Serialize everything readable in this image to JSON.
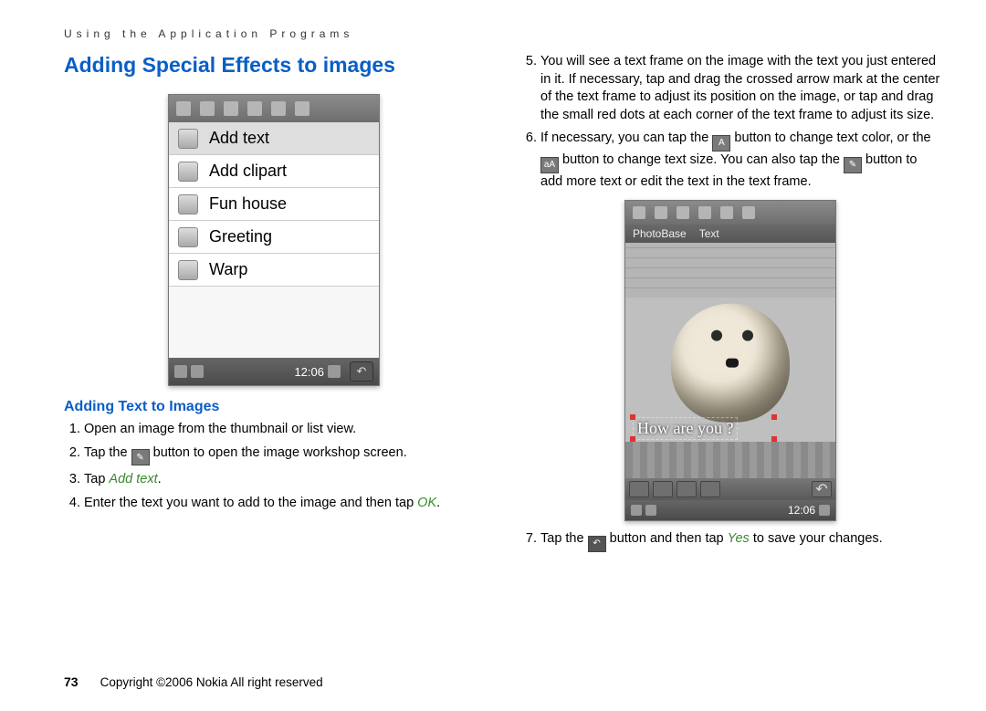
{
  "running_header": "Using the Application Programs",
  "title": "Adding Special Effects to images",
  "subtitle": "Adding Text to Images",
  "menu": {
    "items": [
      "Add text",
      "Add clipart",
      "Fun house",
      "Greeting",
      "Warp"
    ],
    "clock": "12:06"
  },
  "steps_left": {
    "s1": "Open an image from the thumbnail or list view.",
    "s2_a": "Tap the ",
    "s2_b": " button to open the image workshop screen.",
    "s3_a": "Tap ",
    "s3_kw": "Add text",
    "s3_b": ".",
    "s4_a": "Enter the text you want to add to the image and then tap ",
    "s4_kw": "OK",
    "s4_b": "."
  },
  "steps_right": {
    "s5": "You will see a text frame on the image with the text you just entered in it. If necessary, tap and drag the crossed arrow mark at the center of the text frame to adjust its position on the image, or tap and drag the small red dots at each corner of the text frame to adjust its size.",
    "s6_a": "If necessary, you can tap the ",
    "s6_b": " button to change text color, or the ",
    "s6_c": " button to change text size. You can also tap the ",
    "s6_d": " button to add more text or edit the text in the text frame.",
    "s7_a": "Tap the ",
    "s7_b": " button and then tap ",
    "s7_kw": "Yes",
    "s7_c": " to save your changes."
  },
  "photobase": {
    "menu1": "PhotoBase",
    "menu2": "Text",
    "overlay": "How are you ?",
    "clock": "12:06"
  },
  "footer": {
    "page": "73",
    "copyright": "Copyright ©2006 Nokia All right reserved"
  }
}
